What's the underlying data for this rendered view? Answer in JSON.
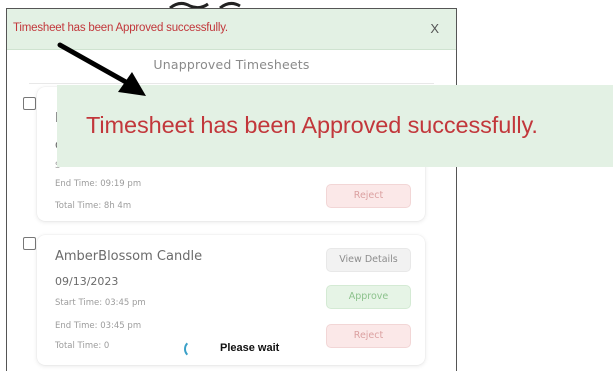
{
  "toast": {
    "message": "Timesheet has been Approved successfully.",
    "close_label": "X"
  },
  "callout": {
    "message": "Timesheet has been Approved successfully."
  },
  "panel": {
    "title": "Unapproved Timesheets"
  },
  "cards": [
    {
      "title_fragment": "F",
      "date_fragment": "C",
      "start_fragment": "S",
      "end_time": "End Time: 09:19 pm",
      "total_time": "Total Time: 8h 4m",
      "buttons": {
        "reject": "Reject"
      }
    },
    {
      "title": "AmberBlossom Candle",
      "date": "09/13/2023",
      "start_time": "Start Time: 03:45 pm",
      "end_time": "End Time: 03:45 pm",
      "total_time": "Total Time: 0",
      "buttons": {
        "view_details": "View Details",
        "approve": "Approve",
        "reject": "Reject"
      }
    }
  ],
  "loader": {
    "text": "Please wait"
  },
  "colors": {
    "toast_bg": "#e3f1e4",
    "toast_text": "#c2373b",
    "approve": "#8cc28c",
    "reject": "#dba0a0"
  },
  "icons": {
    "close": "close-icon",
    "spinner": "spinner-icon",
    "arrow": "arrow-annotation-icon"
  }
}
